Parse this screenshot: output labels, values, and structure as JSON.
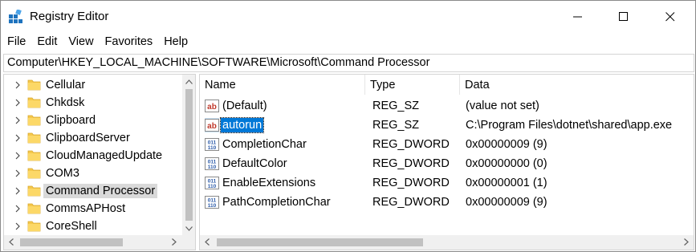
{
  "window": {
    "title": "Registry Editor",
    "controls": {
      "minimize": "minimize",
      "maximize": "maximize",
      "close": "close"
    }
  },
  "menu": [
    "File",
    "Edit",
    "View",
    "Favorites",
    "Help"
  ],
  "address": "Computer\\HKEY_LOCAL_MACHINE\\SOFTWARE\\Microsoft\\Command Processor",
  "tree": {
    "items": [
      {
        "label": "Cellular",
        "selected": false
      },
      {
        "label": "Chkdsk",
        "selected": false
      },
      {
        "label": "Clipboard",
        "selected": false
      },
      {
        "label": "ClipboardServer",
        "selected": false
      },
      {
        "label": "CloudManagedUpdate",
        "selected": false
      },
      {
        "label": "COM3",
        "selected": false
      },
      {
        "label": "Command Processor",
        "selected": true
      },
      {
        "label": "CommsAPHost",
        "selected": false
      },
      {
        "label": "CoreShell",
        "selected": false
      }
    ]
  },
  "values": {
    "columns": [
      "Name",
      "Type",
      "Data"
    ],
    "rows": [
      {
        "name": "(Default)",
        "type": "REG_SZ",
        "data": "(value not set)",
        "icon": "string-value-icon",
        "selected": false
      },
      {
        "name": "autorun",
        "type": "REG_SZ",
        "data": "C:\\Program Files\\dotnet\\shared\\app.exe",
        "icon": "string-value-icon",
        "selected": true
      },
      {
        "name": "CompletionChar",
        "type": "REG_DWORD",
        "data": "0x00000009 (9)",
        "icon": "binary-value-icon",
        "selected": false
      },
      {
        "name": "DefaultColor",
        "type": "REG_DWORD",
        "data": "0x00000000 (0)",
        "icon": "binary-value-icon",
        "selected": false
      },
      {
        "name": "EnableExtensions",
        "type": "REG_DWORD",
        "data": "0x00000001 (1)",
        "icon": "binary-value-icon",
        "selected": false
      },
      {
        "name": "PathCompletionChar",
        "type": "REG_DWORD",
        "data": "0x00000009 (9)",
        "icon": "binary-value-icon",
        "selected": false
      }
    ]
  },
  "colors": {
    "selection_blue": "#0078d7",
    "tree_selected": "#d9d9d9",
    "folder_yellow": "#f5c84c",
    "string_icon_red": "#c0392b",
    "dword_icon_blue": "#2b5aa8"
  }
}
